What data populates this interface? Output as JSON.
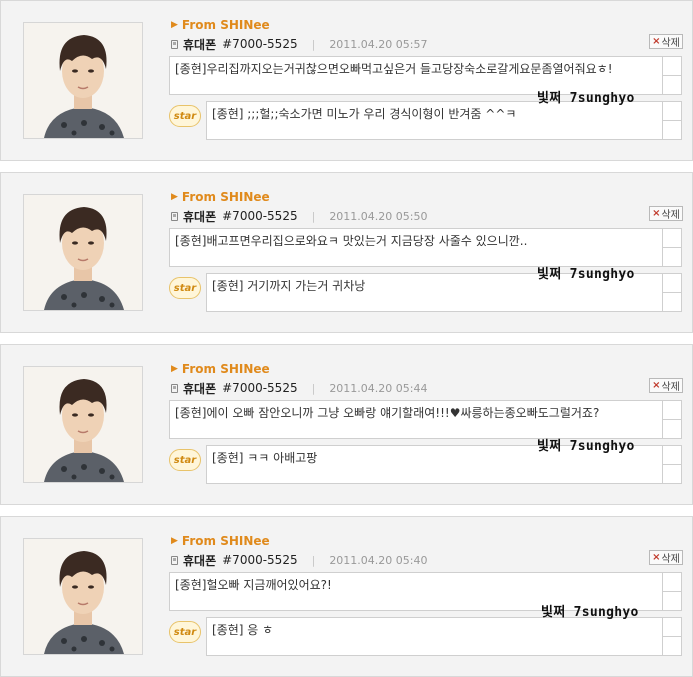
{
  "posts": [
    {
      "from_label": "From SHINee",
      "device": "휴대폰",
      "phone": "#7000-5525",
      "separator": "|",
      "timestamp": "2011.04.20 05:57",
      "delete_label": "삭제",
      "message": "[종현]우리집까지오는거귀찮으면오빠먹고싶은거 들고당장숙소로갈게요문좀열어줘요ㅎ!",
      "reply": "[종현] ;;;헐;;숙소가면 미노가 우리 경식이형이 반겨줌 ^^ㅋ",
      "watermark": "빛쩌 7sunghyo",
      "star_label": "star"
    },
    {
      "from_label": "From SHINee",
      "device": "휴대폰",
      "phone": "#7000-5525",
      "separator": "|",
      "timestamp": "2011.04.20 05:50",
      "delete_label": "삭제",
      "message": "[종현]배고프면우리집으로와요ㅋ 맛있는거 지금당장 사줄수 있으니깐..",
      "reply": "[종현] 거기까지 가는거 귀차낭",
      "watermark": "빛쩌 7sunghyo",
      "star_label": "star"
    },
    {
      "from_label": "From SHINee",
      "device": "휴대폰",
      "phone": "#7000-5525",
      "separator": "|",
      "timestamp": "2011.04.20 05:44",
      "delete_label": "삭제",
      "message": "[종현]에이 오빠 잠안오니까 그냥 오빠랑 얘기할래여!!!♥싸릉하는종오빠도그럴거죠?",
      "reply": "[종현] ㅋㅋ 아배고팡",
      "watermark": "빛쩌 7sunghyo",
      "star_label": "star"
    },
    {
      "from_label": "From SHINee",
      "device": "휴대폰",
      "phone": "#7000-5525",
      "separator": "|",
      "timestamp": "2011.04.20 05:40",
      "delete_label": "삭제",
      "message": "[종현]헐오빠 지금깨어있어요?!",
      "reply": "[종현] 응 ㅎ",
      "watermark": "빛쩌 7sunghyo",
      "star_label": "star"
    }
  ]
}
